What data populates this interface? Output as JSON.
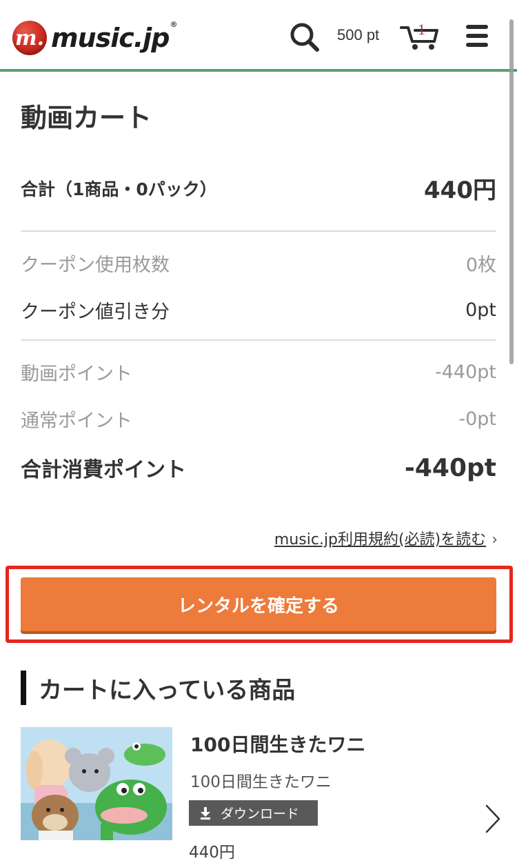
{
  "header": {
    "logo_mark": "m.",
    "logo_text": "music.jp",
    "logo_reg": "®",
    "points": "500 pt",
    "cart_count": "1",
    "icons": {
      "search": "search-icon",
      "cart": "cart-icon",
      "menu": "menu-icon"
    }
  },
  "page": {
    "title": "動画カート"
  },
  "summary": {
    "total_label": "合計（1商品・0パック）",
    "total_value": "440円",
    "coupon_count_label": "クーポン使用枚数",
    "coupon_count_value": "0枚",
    "coupon_discount_label": "クーポン値引き分",
    "coupon_discount_value": "0pt",
    "video_points_label": "動画ポイント",
    "video_points_value": "-440pt",
    "normal_points_label": "通常ポイント",
    "normal_points_value": "-0pt",
    "total_points_label": "合計消費ポイント",
    "total_points_value": "-440pt"
  },
  "terms": {
    "link_text": "music.jp利用規約(必読)を読む",
    "chevron": "›"
  },
  "confirm": {
    "label": "レンタルを確定する"
  },
  "cart_items": {
    "section_title": "カートに入っている商品",
    "items": [
      {
        "title": "100日間生きたワニ",
        "subtitle": "100日間生きたワニ",
        "badge": "ダウンロード",
        "price": "440円"
      }
    ]
  },
  "colors": {
    "accent_orange": "#ec7b3c",
    "highlight_red": "#e5261c",
    "header_line_green": "#5a9c74",
    "logo_red": "#c8261c"
  }
}
